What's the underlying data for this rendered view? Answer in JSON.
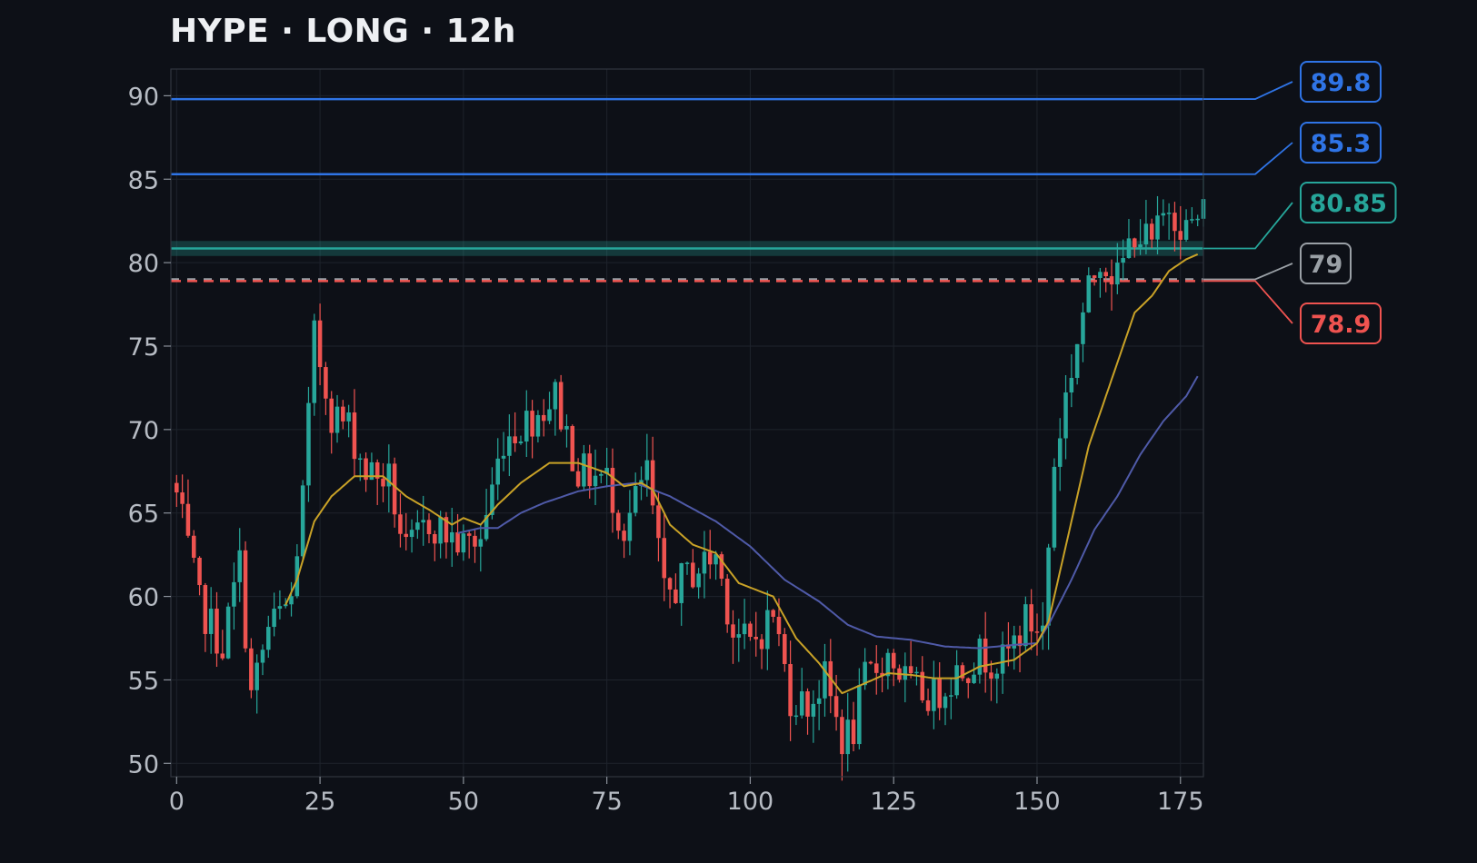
{
  "title": "HYPE · LONG · 12h",
  "colors": {
    "background": "#0d1017",
    "bull": "#27a69a",
    "bear": "#ef5350",
    "ma_fast": "#c9a227",
    "ma_slow": "#4f5aa8",
    "target": "#2f74e6",
    "entry": "#26a69a",
    "current": "#9aa0a6",
    "stop": "#ef5350"
  },
  "chart_data": {
    "type": "candlestick",
    "x_ticks": [
      "0",
      "25",
      "50",
      "75",
      "100",
      "125",
      "150",
      "175"
    ],
    "y_ticks": [
      "50",
      "55",
      "60",
      "65",
      "70",
      "75",
      "80",
      "85",
      "90"
    ],
    "xlim": [
      -1,
      179
    ],
    "ylim": [
      49.2,
      91.6
    ],
    "grid": true,
    "close_anchors": [
      [
        0,
        66
      ],
      [
        4,
        59.5
      ],
      [
        8,
        57
      ],
      [
        11,
        62
      ],
      [
        13,
        54
      ],
      [
        16,
        58
      ],
      [
        20,
        59.8
      ],
      [
        22,
        66
      ],
      [
        24,
        75.5
      ],
      [
        27,
        71
      ],
      [
        30,
        70.2
      ],
      [
        33,
        67.5
      ],
      [
        37,
        67
      ],
      [
        40,
        62.5
      ],
      [
        44,
        64.5
      ],
      [
        50,
        63
      ],
      [
        53,
        63.5
      ],
      [
        57,
        69.5
      ],
      [
        63,
        71
      ],
      [
        66,
        72
      ],
      [
        70,
        67.5
      ],
      [
        75,
        67
      ],
      [
        78,
        64
      ],
      [
        82,
        67.5
      ],
      [
        85,
        60
      ],
      [
        90,
        61.5
      ],
      [
        94,
        62.5
      ],
      [
        97,
        58
      ],
      [
        100,
        57
      ],
      [
        104,
        59
      ],
      [
        107,
        54
      ],
      [
        110,
        53.5
      ],
      [
        113,
        55
      ],
      [
        116,
        51.5
      ],
      [
        118,
        52
      ],
      [
        120,
        55
      ],
      [
        124,
        56.5
      ],
      [
        128,
        54.5
      ],
      [
        132,
        54
      ],
      [
        136,
        55.5
      ],
      [
        140,
        56.5
      ],
      [
        144,
        56
      ],
      [
        148,
        58.5
      ],
      [
        151,
        58
      ],
      [
        153,
        68
      ],
      [
        155,
        72
      ],
      [
        158,
        77
      ],
      [
        161,
        80.5
      ],
      [
        164,
        79
      ],
      [
        167,
        82
      ],
      [
        170,
        81
      ],
      [
        173,
        83.5
      ],
      [
        176,
        82
      ],
      [
        179,
        83
      ]
    ],
    "ma_fast_anchors": [
      [
        19,
        59.5
      ],
      [
        21,
        61
      ],
      [
        24,
        64.5
      ],
      [
        27,
        66
      ],
      [
        31,
        67.2
      ],
      [
        36,
        67.2
      ],
      [
        40,
        66
      ],
      [
        44,
        65.2
      ],
      [
        48,
        64.3
      ],
      [
        50,
        64.7
      ],
      [
        53,
        64.3
      ],
      [
        56,
        65.5
      ],
      [
        60,
        66.8
      ],
      [
        65,
        68
      ],
      [
        70,
        68
      ],
      [
        75,
        67.4
      ],
      [
        78,
        66.6
      ],
      [
        81,
        66.8
      ],
      [
        83,
        66.4
      ],
      [
        86,
        64.3
      ],
      [
        90,
        63.1
      ],
      [
        94,
        62.6
      ],
      [
        98,
        60.8
      ],
      [
        104,
        60
      ],
      [
        108,
        57.5
      ],
      [
        112,
        56
      ],
      [
        116,
        54.2
      ],
      [
        120,
        54.8
      ],
      [
        124,
        55.4
      ],
      [
        128,
        55.3
      ],
      [
        132,
        55.1
      ],
      [
        136,
        55.1
      ],
      [
        140,
        55.8
      ],
      [
        146,
        56.2
      ],
      [
        150,
        57.2
      ],
      [
        152,
        58.5
      ],
      [
        155,
        63
      ],
      [
        159,
        69
      ],
      [
        163,
        73
      ],
      [
        167,
        77
      ],
      [
        170,
        78
      ],
      [
        173,
        79.5
      ],
      [
        176,
        80.2
      ],
      [
        178,
        80.5
      ]
    ],
    "ma_slow_anchors": [
      [
        49,
        63.8
      ],
      [
        53,
        64.1
      ],
      [
        56,
        64.1
      ],
      [
        60,
        65
      ],
      [
        64,
        65.6
      ],
      [
        70,
        66.3
      ],
      [
        75,
        66.6
      ],
      [
        80,
        66.8
      ],
      [
        86,
        66
      ],
      [
        94,
        64.5
      ],
      [
        100,
        63
      ],
      [
        106,
        61
      ],
      [
        112,
        59.7
      ],
      [
        117,
        58.3
      ],
      [
        122,
        57.6
      ],
      [
        128,
        57.4
      ],
      [
        134,
        57
      ],
      [
        140,
        56.9
      ],
      [
        146,
        57.1
      ],
      [
        150,
        57.2
      ],
      [
        152,
        58.3
      ],
      [
        156,
        61
      ],
      [
        160,
        64
      ],
      [
        164,
        66
      ],
      [
        168,
        68.5
      ],
      [
        172,
        70.5
      ],
      [
        176,
        72
      ],
      [
        178,
        73.2
      ]
    ],
    "levels": [
      {
        "role": "target",
        "price": 89.8,
        "label": "89.8",
        "style": "solid"
      },
      {
        "role": "target",
        "price": 85.3,
        "label": "85.3",
        "style": "solid"
      },
      {
        "role": "entry",
        "price": 80.85,
        "label": "80.85",
        "style": "zone",
        "band": [
          80.4,
          81.3
        ]
      },
      {
        "role": "current",
        "price": 79,
        "label": "79",
        "style": "dashed"
      },
      {
        "role": "stop",
        "price": 78.9,
        "label": "78.9",
        "style": "dashed"
      }
    ]
  }
}
